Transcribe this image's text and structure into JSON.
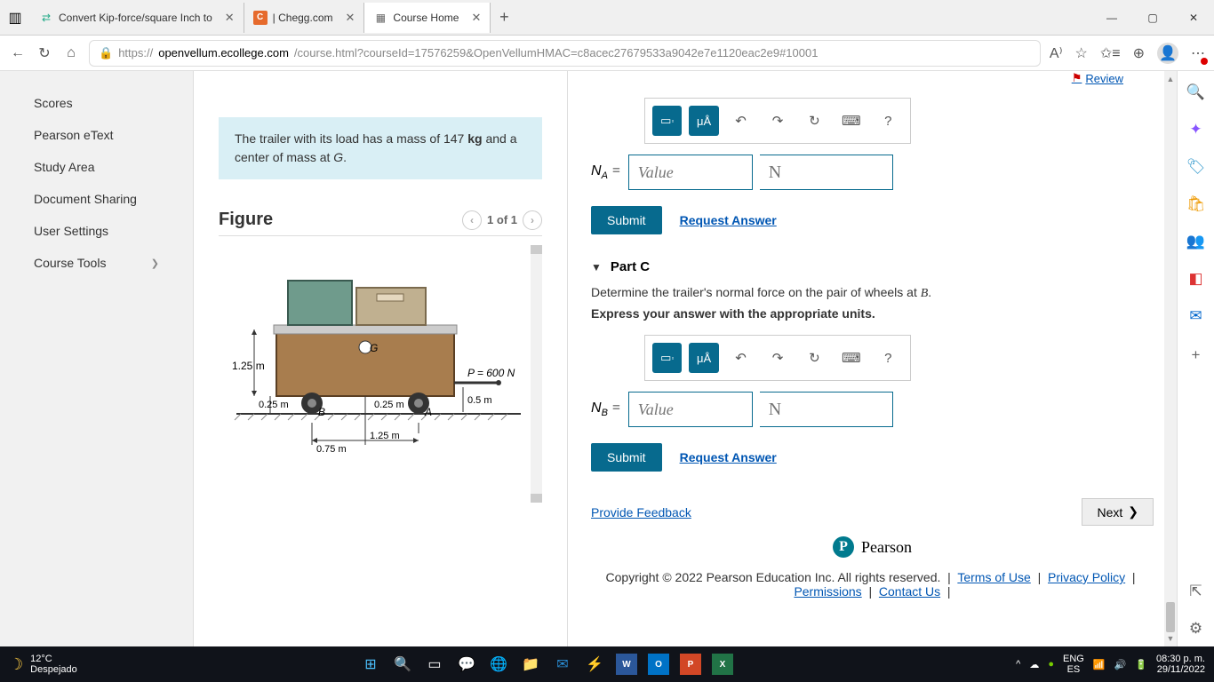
{
  "browser": {
    "tabs": [
      {
        "title": "Convert Kip-force/square Inch to"
      },
      {
        "title": "| Chegg.com"
      },
      {
        "title": "Course Home"
      }
    ],
    "url_domain": "openvellum.ecollege.com",
    "url_path": "/course.html?courseId=17576259&OpenVellumHMAC=c8acec27679533a9042e7e1120eac2e9#10001",
    "url_proto": "https://"
  },
  "sidebar": {
    "items": [
      {
        "label": "Scores"
      },
      {
        "label": "Pearson eText"
      },
      {
        "label": "Study Area"
      },
      {
        "label": "Document Sharing"
      },
      {
        "label": "User Settings"
      },
      {
        "label": "Course Tools",
        "chev": "❯"
      }
    ]
  },
  "review": {
    "label": "Review"
  },
  "problem": {
    "text_a": "The trailer with its load has a mass of 147 ",
    "unit": "kg",
    "text_b": " and a center of mass at ",
    "g": "G",
    "text_c": "."
  },
  "figure": {
    "title": "Figure",
    "pager": "1 of 1",
    "labels": {
      "h1": "1.25 m",
      "h2": "0.25 m",
      "h3": "0.25 m",
      "P": "P = 600 N",
      "d05": "0.5 m",
      "d125": "1.25 m",
      "d075": "0.75 m",
      "G": "G",
      "A": "A",
      "B": "B"
    }
  },
  "partA": {
    "label_var": "N",
    "label_sub": "A",
    "value_placeholder": "Value",
    "unit_placeholder": "N",
    "submit": "Submit",
    "request": "Request Answer",
    "ua": "μÅ"
  },
  "partC": {
    "header": "Part C",
    "prompt_a": "Determine the trailer's normal force on the pair of wheels at ",
    "prompt_b": "B",
    "prompt_c": ".",
    "instruct": "Express your answer with the appropriate units.",
    "label_var": "N",
    "label_sub": "B",
    "value_placeholder": "Value",
    "unit_placeholder": "N",
    "submit": "Submit",
    "request": "Request Answer",
    "ua": "μÅ"
  },
  "feedback": {
    "label": "Provide Feedback"
  },
  "next": {
    "label": "Next"
  },
  "pearson": {
    "label": "Pearson"
  },
  "footer": {
    "copy": "Copyright © 2022 Pearson Education Inc. All rights reserved.",
    "links": [
      "Terms of Use",
      "Privacy Policy",
      "Permissions",
      "Contact Us"
    ]
  },
  "taskbar": {
    "temp": "12°C",
    "weather": "Despejado",
    "lang1": "ENG",
    "lang2": "ES",
    "time": "08:30 p. m.",
    "date": "29/11/2022"
  }
}
